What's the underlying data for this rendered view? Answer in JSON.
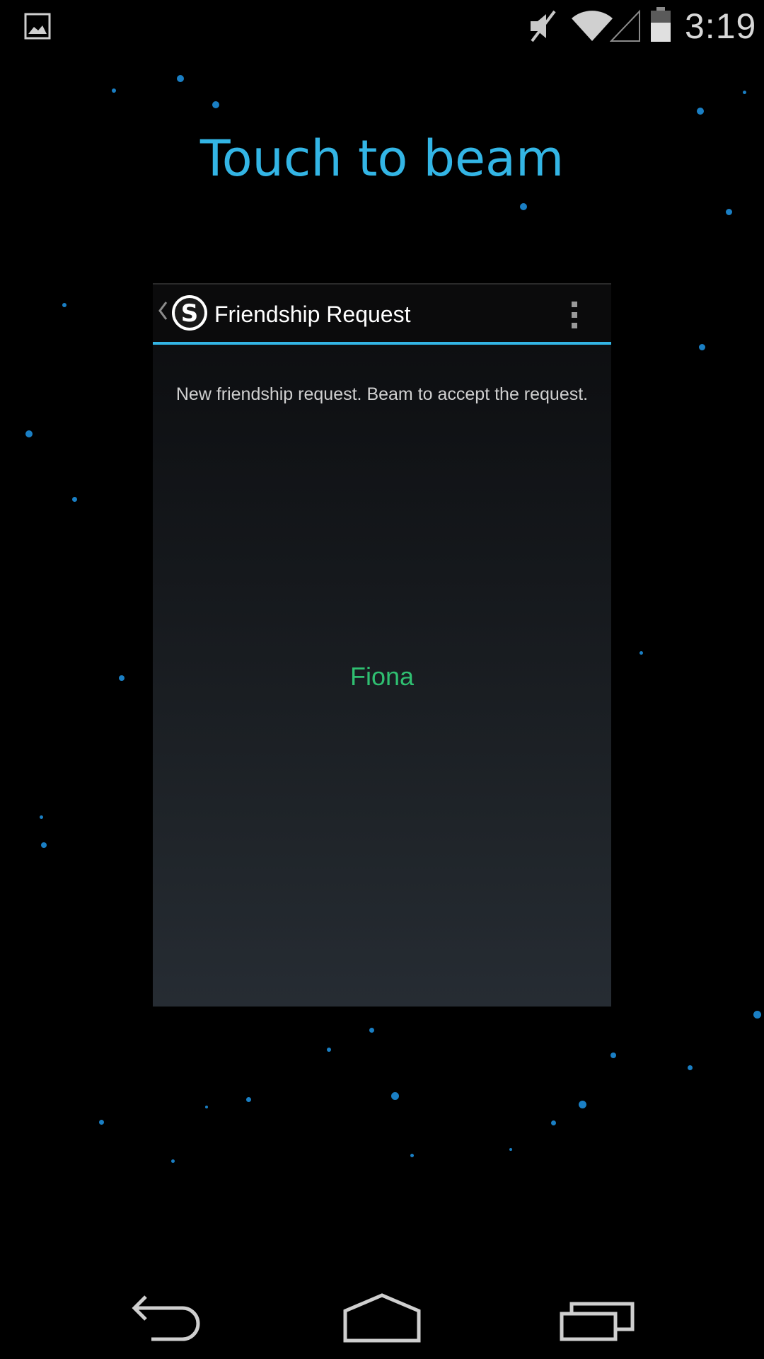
{
  "status_bar": {
    "time": "3:19",
    "icons": [
      "gallery-notification-icon",
      "mute-icon",
      "wifi-icon",
      "cell-signal-icon",
      "battery-icon"
    ]
  },
  "headline": "Touch to beam",
  "card": {
    "action_bar": {
      "title": "Friendship Request",
      "app_icon": "skype-logo-icon",
      "overflow_icon": "overflow-menu-icon"
    },
    "message": "New friendship request. Beam to accept the request.",
    "friend_name": "Fiona"
  },
  "nav_bar": {
    "icons": [
      "back-icon",
      "home-icon",
      "recent-apps-icon"
    ]
  },
  "colors": {
    "accent": "#33b5e5",
    "friend_name": "#2fbf71",
    "background": "#000000"
  }
}
